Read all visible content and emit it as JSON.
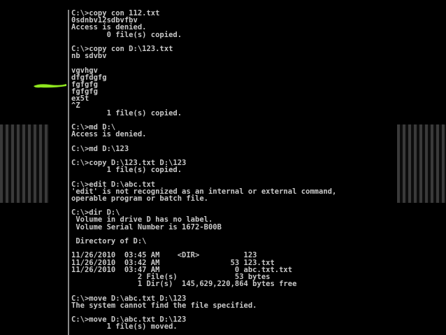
{
  "console": {
    "lines": [
      "C:\\>copy con 112.txt",
      "0sdnbv12sdbvfbv",
      "Access is denied.",
      "        0 file(s) copied.",
      "",
      "C:\\>copy con D:\\123.txt",
      "nb sdvbv",
      "",
      "vgvhgv",
      "dfgfdgfg",
      "fgfgfg",
      "fgfgfg",
      "ex5t",
      "^Z",
      "        1 file(s) copied.",
      "",
      "C:\\>md D:\\",
      "Access is denied.",
      "",
      "C:\\>md D:\\123",
      "",
      "C:\\>copy D:\\123.txt D:\\123",
      "        1 file(s) copied.",
      "",
      "C:\\>edit D:\\abc.txt",
      "'edit' is not recognized as an internal or external command,",
      "operable program or batch file.",
      "",
      "C:\\>dir D:\\",
      " Volume in drive D has no label.",
      " Volume Serial Number is 1672-B00B",
      "",
      " Directory of D:\\",
      "",
      "11/26/2010  03:45 AM    <DIR>          123",
      "11/26/2010  03:42 AM                53 123.txt",
      "11/26/2010  03:47 AM                 0 abc.txt.txt",
      "               2 File(s)             53 bytes",
      "               1 Dir(s)  145,629,220,864 bytes free",
      "",
      "C:\\>move D:\\abc.txt D:\\123",
      "The system cannot find the file specified.",
      "",
      "C:\\>move D:\\abc.txt D:\\123",
      "        1 file(s) moved."
    ]
  },
  "colors": {
    "background": "#000000",
    "text": "#c8c8c8",
    "marker": "#8fe61e"
  }
}
